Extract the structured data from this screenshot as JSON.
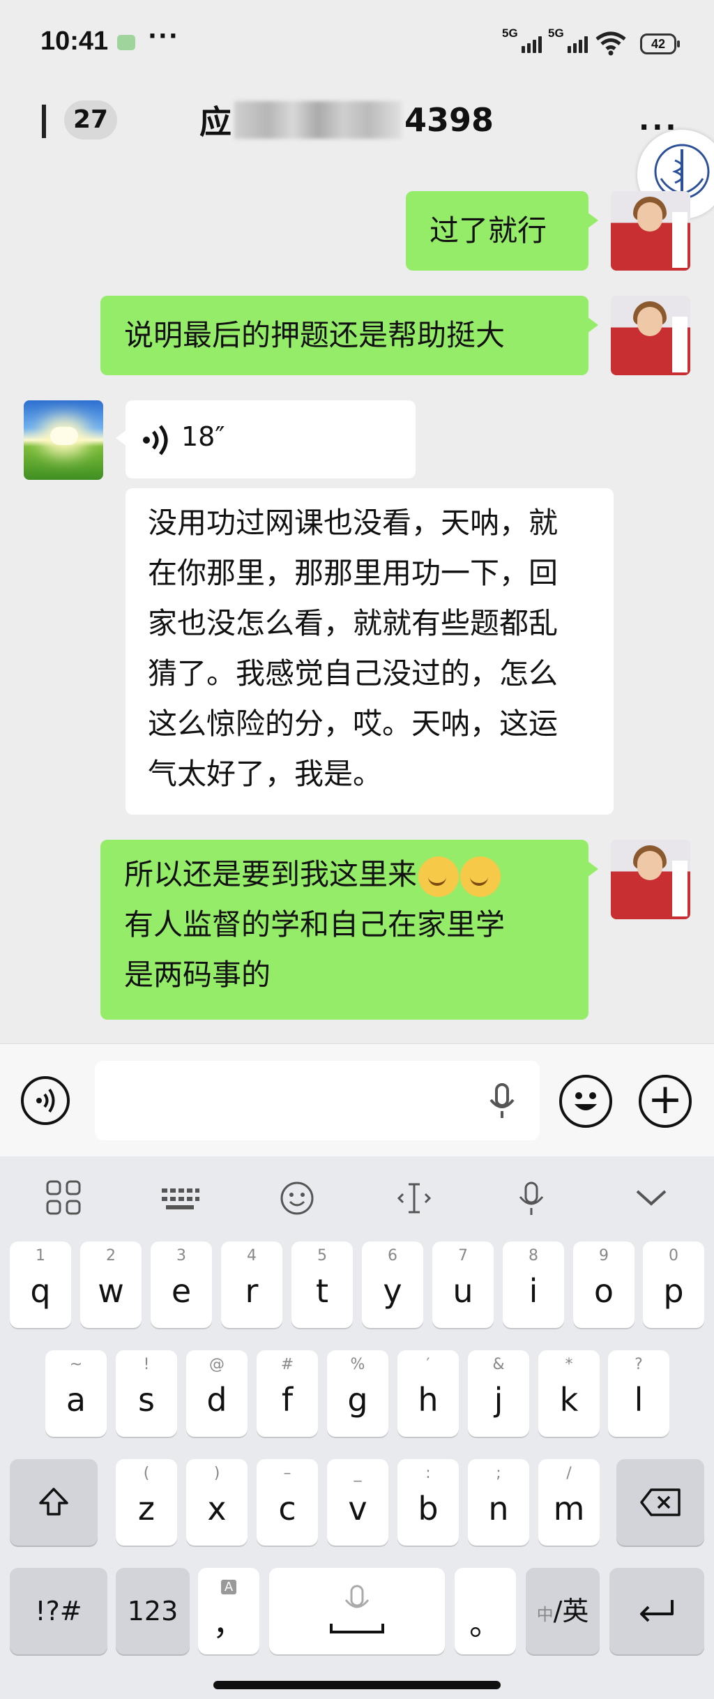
{
  "status_bar": {
    "time": "10:41",
    "more": "···",
    "sim1": "5G",
    "sim2": "5G",
    "battery": "42"
  },
  "header": {
    "unread_count": "27",
    "title_prefix": "应",
    "title_suffix": "4398",
    "more": "···"
  },
  "messages": [
    {
      "side": "me",
      "lines": [
        "过了就行"
      ]
    },
    {
      "side": "me",
      "lines": [
        "说明最后的押题还是帮助挺大"
      ]
    },
    {
      "side": "them",
      "type": "voice",
      "duration": "18″"
    },
    {
      "side": "them",
      "lines": [
        "没用功过网课也没看，天呐，就",
        "在你那里，那那里用功一下，回",
        "家也没怎么看，就就有些题都乱",
        "猜了。我感觉自己没过的，怎么",
        "这么惊险的分，哎。天呐，这运",
        "气太好了，我是。"
      ]
    },
    {
      "side": "me",
      "lines": [
        "所以还是要到我这里来",
        "有人监督的学和自己在家里学",
        "是两码事的"
      ],
      "emoji": [
        "hugging-face",
        "hugging-face"
      ]
    }
  ],
  "keyboard": {
    "row1": [
      {
        "k": "q",
        "s": "1"
      },
      {
        "k": "w",
        "s": "2"
      },
      {
        "k": "e",
        "s": "3"
      },
      {
        "k": "r",
        "s": "4"
      },
      {
        "k": "t",
        "s": "5"
      },
      {
        "k": "y",
        "s": "6"
      },
      {
        "k": "u",
        "s": "7"
      },
      {
        "k": "i",
        "s": "8"
      },
      {
        "k": "o",
        "s": "9"
      },
      {
        "k": "p",
        "s": "0"
      }
    ],
    "row2": [
      {
        "k": "a",
        "s": "~"
      },
      {
        "k": "s",
        "s": "!"
      },
      {
        "k": "d",
        "s": "@"
      },
      {
        "k": "f",
        "s": "#"
      },
      {
        "k": "g",
        "s": "%"
      },
      {
        "k": "h",
        "s": "′"
      },
      {
        "k": "j",
        "s": "&"
      },
      {
        "k": "k",
        "s": "*"
      },
      {
        "k": "l",
        "s": "?"
      }
    ],
    "row3": [
      {
        "k": "z",
        "s": "("
      },
      {
        "k": "x",
        "s": ")"
      },
      {
        "k": "c",
        "s": "–"
      },
      {
        "k": "v",
        "s": "_"
      },
      {
        "k": "b",
        "s": ":"
      },
      {
        "k": "n",
        "s": ";"
      },
      {
        "k": "m",
        "s": "/"
      }
    ],
    "symbols": "!?#",
    "numbers": "123",
    "comma": "，",
    "comma_sub": "A",
    "period": "。",
    "lang_small": "中",
    "lang_big": "/英"
  }
}
